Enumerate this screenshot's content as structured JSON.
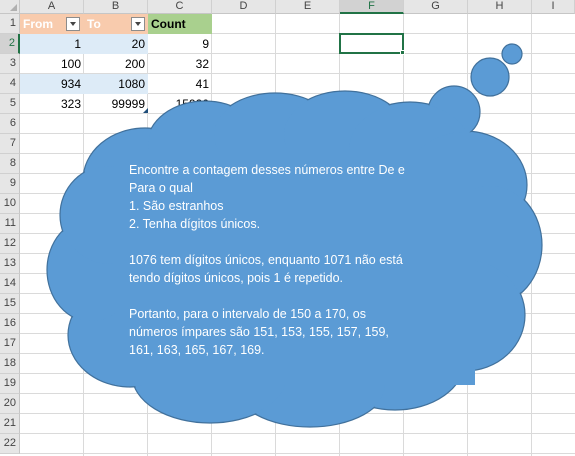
{
  "columns": [
    "A",
    "B",
    "C",
    "D",
    "E",
    "F",
    "G",
    "H",
    "I"
  ],
  "rows": [
    "1",
    "2",
    "3",
    "4",
    "5",
    "6",
    "7",
    "8",
    "9",
    "10",
    "11",
    "12",
    "13",
    "14",
    "15",
    "16",
    "17",
    "18",
    "19",
    "20",
    "21",
    "22"
  ],
  "table": {
    "headers": {
      "from": "From",
      "to": "To",
      "count": "Count"
    },
    "data": [
      {
        "from": "1",
        "to": "20",
        "count": "9"
      },
      {
        "from": "100",
        "to": "200",
        "count": "32"
      },
      {
        "from": "934",
        "to": "1080",
        "count": "41"
      },
      {
        "from": "323",
        "to": "99999",
        "count": "15920"
      }
    ]
  },
  "selection": {
    "column": "F",
    "row": "2"
  },
  "colors": {
    "table_header": "#f8cbad",
    "band_blue": "#ddebf7",
    "count_header": "#a9d08e",
    "cloud_fill": "#5b9bd5",
    "cloud_stroke": "#41719c",
    "accent": "#217346"
  },
  "callout": {
    "line1": "Encontre a contagem desses números entre De e",
    "line2": "Para o qual",
    "line3": "1. São estranhos",
    "line4": "2. Tenha dígitos únicos.",
    "line5": "",
    "line6": "1076 tem dígitos únicos, enquanto 1071 não está",
    "line7": "tendo dígitos únicos, pois 1 é repetido.",
    "line8": "",
    "line9": "Portanto, para o intervalo de 150 a 170, os",
    "line10": "números ímpares são 151, 153, 155, 157, 159,",
    "line11": "161, 163, 165, 167, 169."
  }
}
